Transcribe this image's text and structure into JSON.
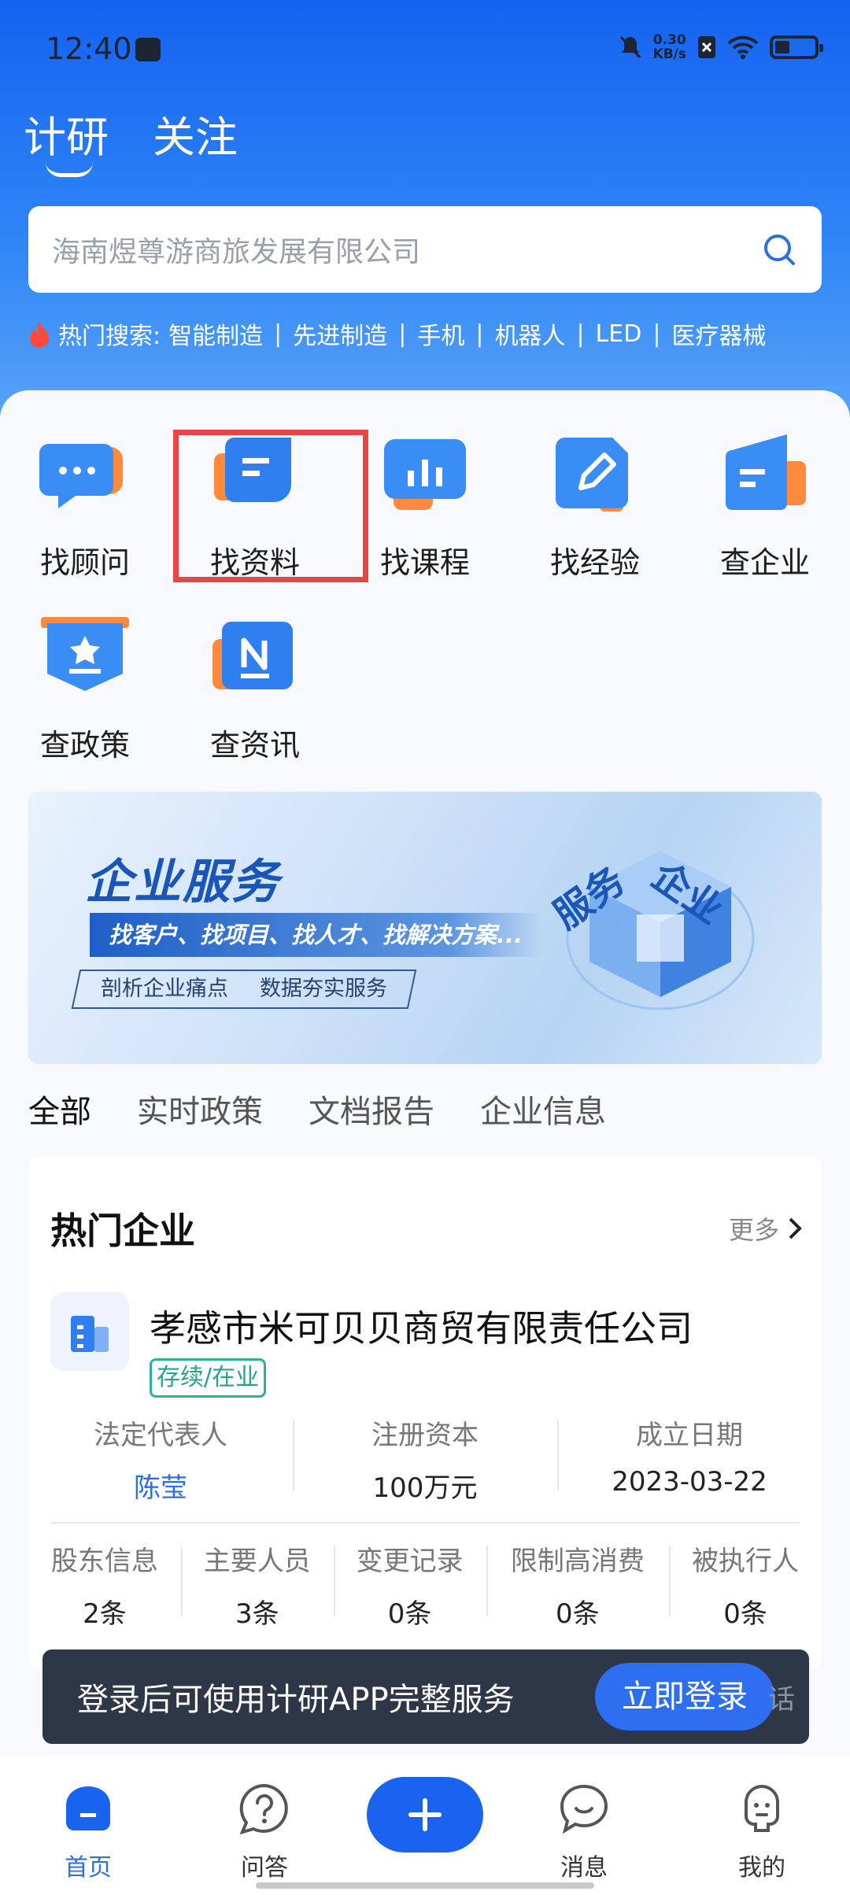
{
  "status_bar": {
    "time": "12:40",
    "speed_top": "0.30",
    "speed_bottom": "KB/s"
  },
  "top_tabs": [
    "计研",
    "关注"
  ],
  "search": {
    "placeholder": "海南煜尊游商旅发展有限公司"
  },
  "hot_search": {
    "label": "热门搜索:",
    "items": [
      "智能制造",
      "先进制造",
      "手机",
      "机器人",
      "LED",
      "医疗器械"
    ]
  },
  "grid": [
    {
      "label": "找顾问",
      "icon": "chat-bubble-icon"
    },
    {
      "label": "找资料",
      "icon": "document-icon"
    },
    {
      "label": "找课程",
      "icon": "bar-chart-icon"
    },
    {
      "label": "找经验",
      "icon": "pencil-icon"
    },
    {
      "label": "查企业",
      "icon": "building-doc-icon"
    },
    {
      "label": "查政策",
      "icon": "star-badge-icon"
    },
    {
      "label": "查资讯",
      "icon": "news-icon"
    }
  ],
  "banner": {
    "title": "企业服务",
    "subtitle": "找客户、找项目、找人才、找解决方案...",
    "tag_left": "剖析企业痛点",
    "tag_right": "数据夯实服务",
    "cube_text_a": "企业",
    "cube_text_b": "服务"
  },
  "category_tabs": [
    "全部",
    "实时政策",
    "文档报告",
    "企业信息"
  ],
  "company": {
    "section_title": "热门企业",
    "more": "更多",
    "name": "孝感市米可贝贝商贸有限责任公司",
    "status": "存续/在业",
    "legal_rep_label": "法定代表人",
    "legal_rep_value": "陈莹",
    "capital_label": "注册资本",
    "capital_value": "100万元",
    "founded_label": "成立日期",
    "founded_value": "2023-03-22",
    "stats": [
      {
        "label": "股东信息",
        "value": "2条"
      },
      {
        "label": "主要人员",
        "value": "3条"
      },
      {
        "label": "变更记录",
        "value": "0条"
      },
      {
        "label": "限制高消费",
        "value": "0条"
      },
      {
        "label": "被执行人",
        "value": "0条"
      }
    ]
  },
  "login_bar": {
    "text": "登录后可使用计研APP完整服务",
    "button": "立即登录",
    "trailing": "话"
  },
  "bottom_nav": [
    {
      "label": "首页",
      "icon": "home-icon"
    },
    {
      "label": "问答",
      "icon": "question-icon"
    },
    {
      "label": "消息",
      "icon": "message-icon"
    },
    {
      "label": "我的",
      "icon": "profile-icon"
    }
  ],
  "colors": {
    "primary": "#1a63ee",
    "header_top": "#1562f0",
    "highlight": "#e84545",
    "status_green": "#23a48b"
  }
}
